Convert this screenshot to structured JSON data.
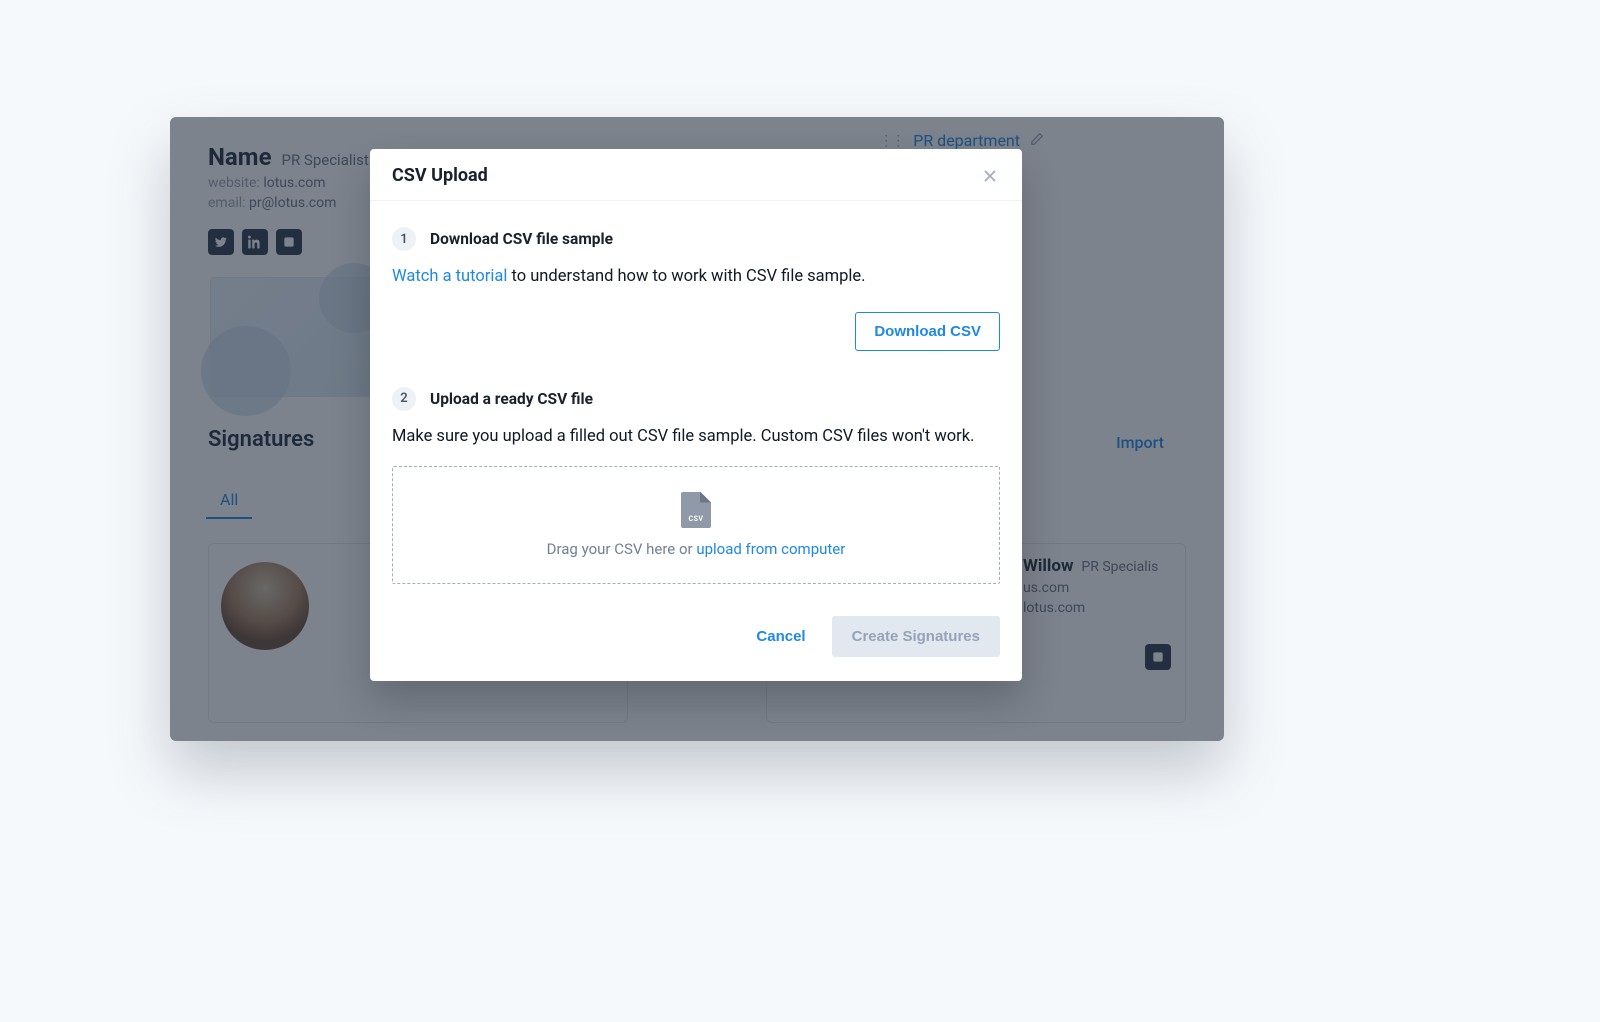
{
  "background": {
    "profile": {
      "name": "Name",
      "role": "PR Specialist at Lotus Ltd",
      "website_label": "website:",
      "website_value": "lotus.com",
      "email_label": "email:",
      "email_value": "pr@lotus.com"
    },
    "department_pill": "PR department",
    "signatures_heading": "Signatures",
    "import_link": "Import",
    "tabs": {
      "all": "All"
    },
    "card_right": {
      "name": "Willow",
      "role": "PR Specialis",
      "line1": "us.com",
      "line2": "lotus.com"
    }
  },
  "modal": {
    "title": "CSV Upload",
    "step1": {
      "num": "1",
      "title": "Download CSV file sample",
      "tutorial_link": "Watch a tutorial",
      "desc_rest": " to understand how to work with CSV file sample.",
      "download_button": "Download CSV"
    },
    "step2": {
      "num": "2",
      "title": "Upload a ready CSV file",
      "desc": "Make sure you upload a filled out CSV file sample. Custom CSV files won't work.",
      "drop_text": "Drag your CSV here or ",
      "drop_link": "upload from computer",
      "file_icon_label": "CSV"
    },
    "footer": {
      "cancel": "Cancel",
      "create": "Create Signatures"
    }
  }
}
